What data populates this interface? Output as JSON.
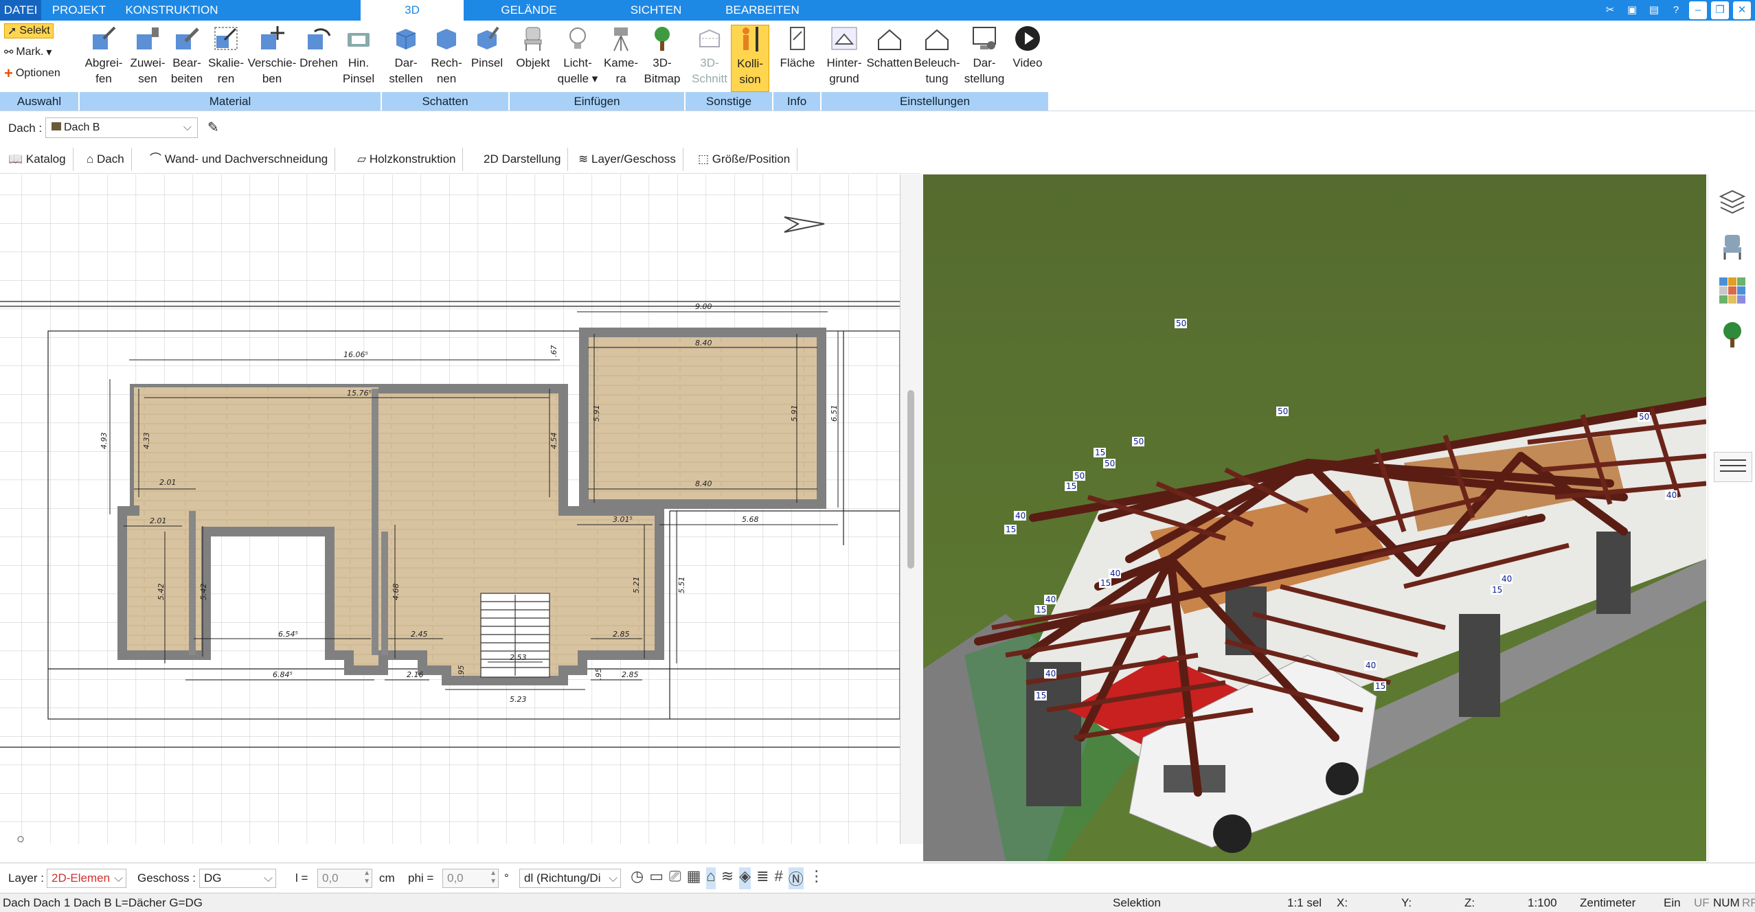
{
  "menu": {
    "tabs": [
      "DATEI",
      "PROJEKT",
      "KONSTRUKTION",
      "3D",
      "GELÄNDE",
      "SICHTEN",
      "BEARBEITEN"
    ],
    "active": "3D"
  },
  "ribbon": {
    "selekt": "Selekt",
    "mark": "Mark.",
    "optionen": "Optionen",
    "buttons": [
      {
        "l1": "Abgrei-",
        "l2": "fen"
      },
      {
        "l1": "Zuwei-",
        "l2": "sen"
      },
      {
        "l1": "Bear-",
        "l2": "beiten"
      },
      {
        "l1": "Skalie-",
        "l2": "ren"
      },
      {
        "l1": "Verschie-",
        "l2": "ben"
      },
      {
        "l1": "Drehen",
        "l2": ""
      },
      {
        "l1": "Hin.",
        "l2": "Pinsel"
      },
      {
        "l1": "Dar-",
        "l2": "stellen"
      },
      {
        "l1": "Rech-",
        "l2": "nen"
      },
      {
        "l1": "Pinsel",
        "l2": ""
      },
      {
        "l1": "Objekt",
        "l2": ""
      },
      {
        "l1": "Licht-",
        "l2": "quelle ▾"
      },
      {
        "l1": "Kame-",
        "l2": "ra"
      },
      {
        "l1": "3D-",
        "l2": "Bitmap"
      },
      {
        "l1": "3D-",
        "l2": "Schnitt"
      },
      {
        "l1": "Kolli-",
        "l2": "sion"
      },
      {
        "l1": "Fläche",
        "l2": ""
      },
      {
        "l1": "Hinter-",
        "l2": "grund"
      },
      {
        "l1": "Schatten",
        "l2": ""
      },
      {
        "l1": "Beleuch-",
        "l2": "tung"
      },
      {
        "l1": "Dar-",
        "l2": "stellung"
      },
      {
        "l1": "Video",
        "l2": ""
      }
    ],
    "groups": [
      "Auswahl",
      "Material",
      "Schatten",
      "Einfügen",
      "Sonstige",
      "Info",
      "Einstellungen"
    ]
  },
  "dach": {
    "label": "Dach :",
    "value": "Dach B"
  },
  "tabs": [
    "Katalog",
    "Dach",
    "Wand- und Dachverschneidung",
    "Holzkonstruktion",
    "2D Darstellung",
    "Layer/Geschoss",
    "Größe/Position"
  ],
  "plan": {
    "dims": [
      "9.00",
      "16.06⁵",
      "8.40",
      "15.76⁵",
      "8.40",
      "6.51",
      "4.93",
      "4.33",
      "4.54",
      "5.91",
      "5.91",
      "2.01",
      "2.01",
      "3.01⁵",
      "5.68",
      "5.42",
      "5.42",
      "4.68",
      "5.21",
      "5.51",
      ".67",
      "6.54⁵",
      "2.45",
      "2.85",
      "2.53",
      "6.84⁵",
      "2.16",
      "2.85",
      ".95",
      ".95",
      "5.23"
    ]
  },
  "view3d": {
    "labels": [
      "50",
      "50",
      "15",
      "50",
      "15",
      "50",
      "50",
      "50",
      "40",
      "15",
      "40",
      "15",
      "40",
      "15",
      "40",
      "40",
      "15",
      "40",
      "15",
      "40",
      "15"
    ]
  },
  "inputbar": {
    "layer_label": "Layer :",
    "layer_value": "2D-Elemen",
    "geschoss_label": "Geschoss :",
    "geschoss_value": "DG",
    "l_label": "l =",
    "l_value": "0,0",
    "l_unit": "cm",
    "phi_label": "phi =",
    "phi_value": "0,0",
    "phi_unit": "°",
    "mode_value": "dl (Richtung/Di"
  },
  "status": {
    "left": "Dach Dach 1 Dach B L=Dächer G=DG",
    "selektion": "Selektion",
    "sel": "1:1 sel",
    "x": "X:",
    "y": "Y:",
    "z": "Z:",
    "scale": "1:100",
    "unit": "Zentimeter",
    "ein": "Ein",
    "uf": "UF",
    "num": "NUM",
    "rf": "RF"
  }
}
